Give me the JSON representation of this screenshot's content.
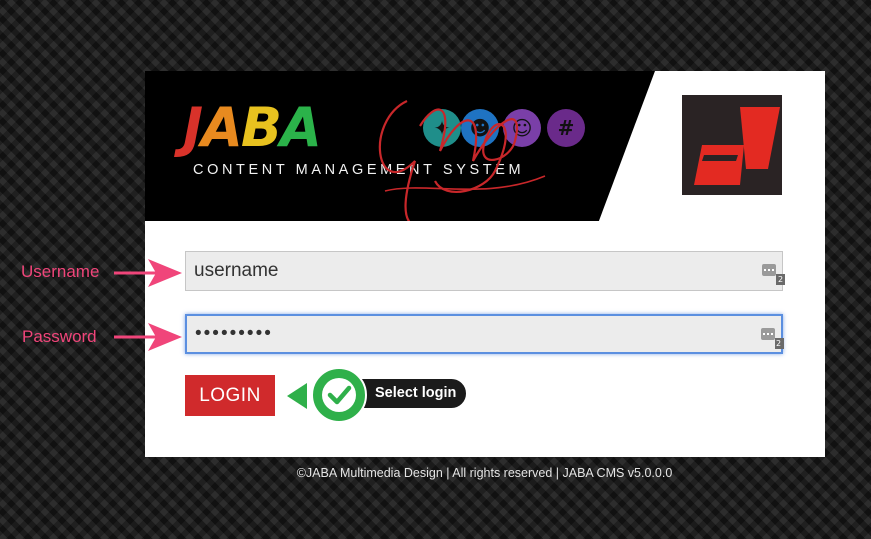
{
  "logo": {
    "brand": "JABA",
    "script_text": "CMS",
    "tagline": "CONTENT MANAGEMENT SYSTEM"
  },
  "form": {
    "username_value": "username",
    "password_value": "•••••••••",
    "password_manager_badge": "2",
    "login_label": "LOGIN"
  },
  "annotations": {
    "username_label": "Username",
    "password_label": "Password",
    "callout_text": "Select login"
  },
  "footer": {
    "text": "©JABA Multimedia Design | All rights reserved | JABA CMS v5.0.0.0"
  },
  "colors": {
    "accent_red": "#d02a2c",
    "annotation_pink": "#f0457a",
    "focus_blue": "#5b8fe0",
    "callout_green": "#2fb04a"
  }
}
